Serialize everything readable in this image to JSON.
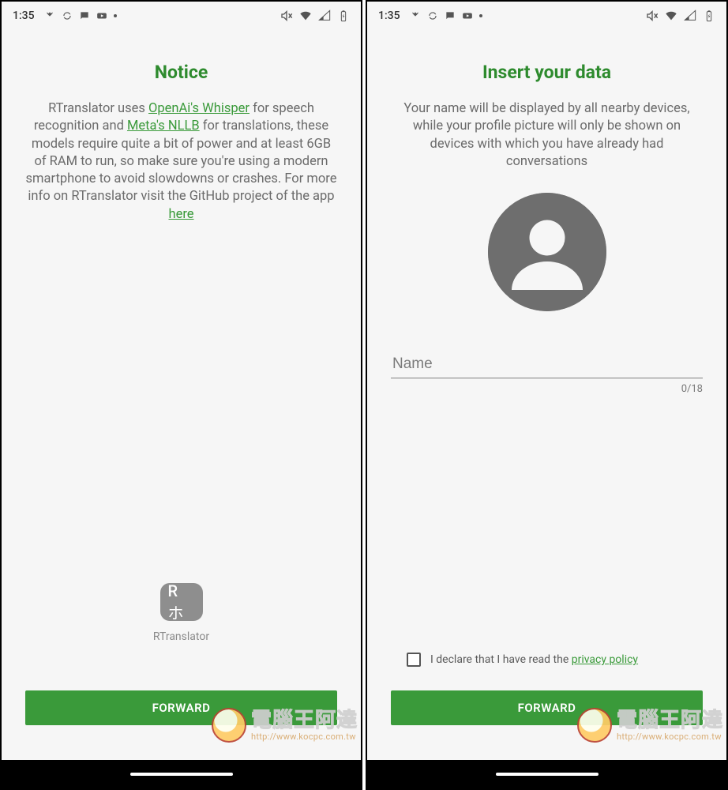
{
  "statusbar": {
    "time": "1:35"
  },
  "screen1": {
    "title": "Notice",
    "desc_part1": "RTranslator uses ",
    "link1": "OpenAi's Whisper",
    "desc_part2": " for speech recognition and ",
    "link2": "Meta's NLLB",
    "desc_part3": " for translations, these models require quite a bit of power and at least 6GB of RAM to run, so make sure you're using a modern smartphone to avoid slowdowns or crashes. For more info on RTranslator visit the GitHub project of the app ",
    "link3": "here",
    "app_chip": "R ホ",
    "app_label": "RTranslator",
    "forward": "FORWARD"
  },
  "screen2": {
    "title": "Insert your data",
    "desc": "Your name will be displayed by all nearby devices, while your profile picture will only be shown on devices with which you have already had conversations",
    "name_placeholder": "Name",
    "counter": "0/18",
    "consent_prefix": "I declare that I have read the ",
    "consent_link": "privacy policy",
    "forward": "FORWARD"
  },
  "watermark": {
    "text": "電腦王阿達",
    "url": "http://www.kocpc.com.tw"
  }
}
